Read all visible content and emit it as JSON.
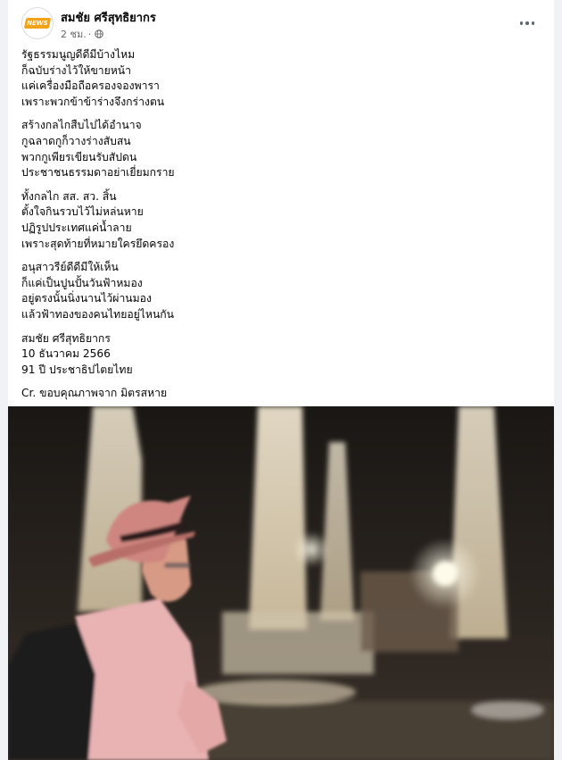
{
  "post": {
    "author": "สมชัย ศรีสุทธิยากร",
    "time": "2 ชม.",
    "separator": "·",
    "privacy_icon": "globe-icon",
    "more_icon": "more-options-icon",
    "avatar_text": "NEWS",
    "body": {
      "stanzas": [
        [
          "รัฐธรรมนูญดีดีมีบ้างไหม",
          "ก็ฉบับร่างไว้ให้ขายหน้า",
          "แค่เครื่องมือถือครองจองพารา",
          "เพราะพวกข้าข้าร่างจึงกร่างตน"
        ],
        [
          "สร้างกลไกสืบไปได้อำนาจ",
          "กูฉลาดกูก็วางร่างสับสน",
          "พวกกูเพียรเขียนรับสัปดน",
          "ประชาชนธรรมดาอย่าเยี่ยมกราย"
        ],
        [
          "ทั้งกลไก สส. สว. สิ้น",
          "ตั้งใจกินรวบไว้ไม่หล่นหาย",
          "ปฏิรูปประเทศแค่น้ำลาย",
          "เพราะสุดท้ายที่หมายใครยึดครอง"
        ],
        [
          "อนุสาวรีย์ดีดีมีให้เห็น",
          "ก็แค่เป็นปูนปั้นวันฟ้าหมอง",
          "อยู่ตรงนั้นนิ่งนานไว้ผ่านมอง",
          "แล้วฟ้าทองของคนไทยอยู่ไหนกัน"
        ],
        [
          "สมชัย ศรีสุทธิยากร",
          "10 ธันวาคม 2566",
          "91 ปี ประชาธิปไตยไทย"
        ],
        [
          "Cr. ขอบคุณภาพจาก มิตรสหาย"
        ]
      ]
    }
  },
  "colors": {
    "page_background": "#f0f2f5",
    "card": "#ffffff",
    "primary_text": "#050505",
    "secondary_text": "#65676b",
    "logo_accent": "#f4a21a"
  },
  "photo": {
    "content": "Man in a pink hat and pink shirt with a backpack, in front of the illuminated Democracy Monument at night"
  }
}
